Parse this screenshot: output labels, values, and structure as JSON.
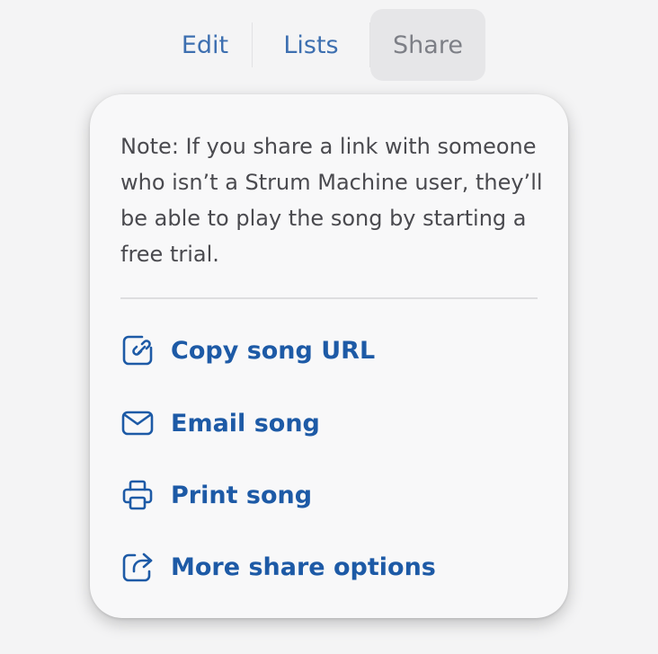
{
  "tabs": {
    "edit_label": "Edit",
    "lists_label": "Lists",
    "share_label": "Share",
    "active": "Share"
  },
  "share_menu": {
    "note": "Note: If you share a link with someone who isn’t a Strum Machine user, they’ll be able to play the song by starting a free trial.",
    "items": [
      {
        "label": "Copy song URL",
        "icon": "copy-link-icon"
      },
      {
        "label": "Email song",
        "icon": "envelope-icon"
      },
      {
        "label": "Print song",
        "icon": "printer-icon"
      },
      {
        "label": "More share options",
        "icon": "share-arrow-icon"
      }
    ]
  },
  "colors": {
    "background": "#f4f4f5",
    "tab_link": "#3d6fb0",
    "tab_active_bg": "#e6e6e8",
    "tab_active_text": "#7d7f86",
    "menu_link": "#1d5aa6",
    "note_text": "#4a4a4f"
  }
}
